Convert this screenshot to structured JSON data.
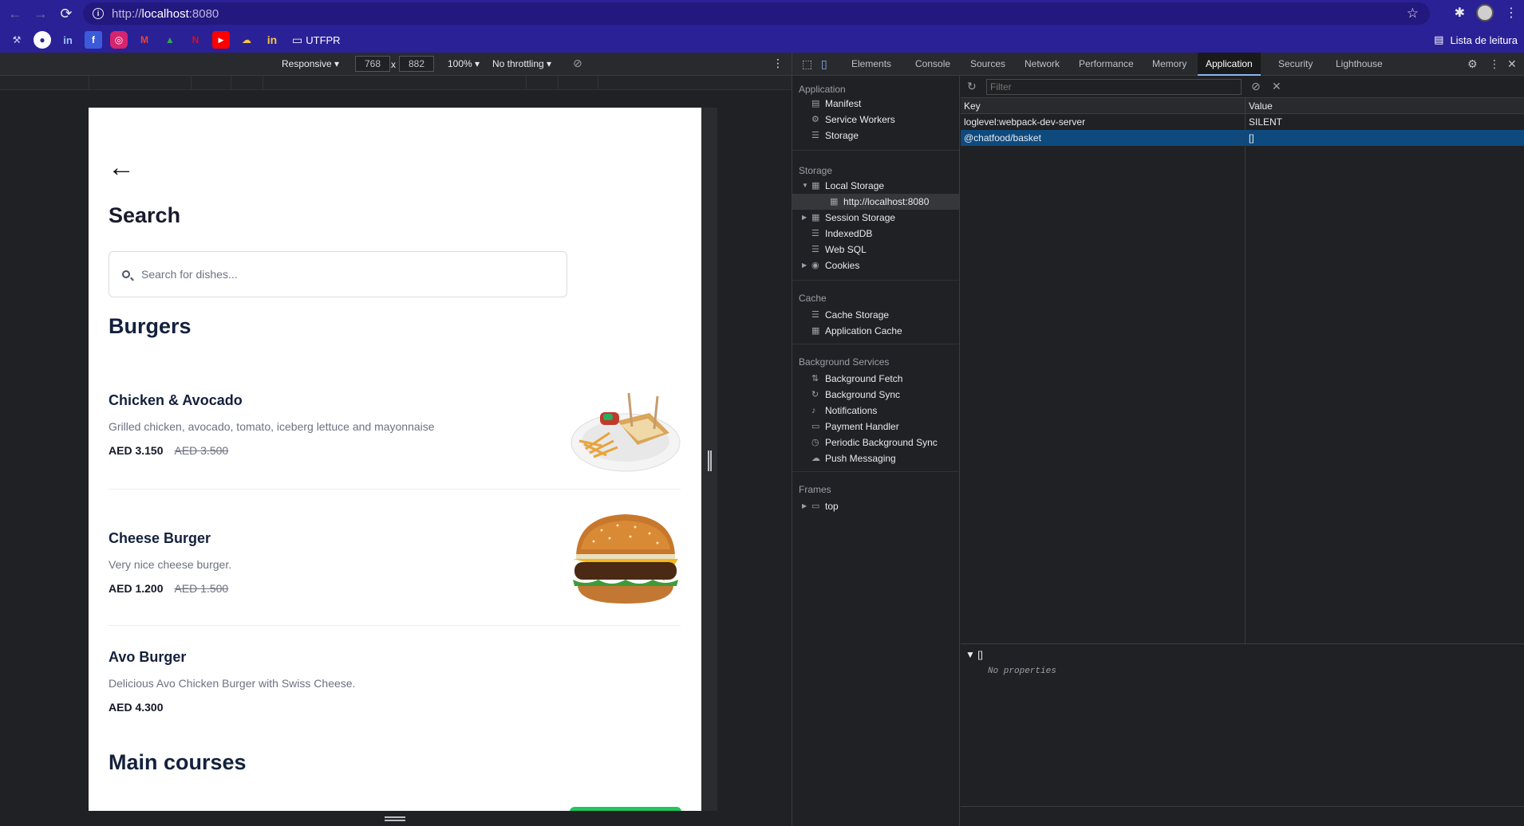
{
  "browser": {
    "url_scheme": "http://",
    "url_host": "localhost",
    "url_port": ":8080",
    "bookmark_folder": "UTFPR",
    "reading_list": "Lista de leitura",
    "bookmark_icons": [
      "tools-icon",
      "github-icon",
      "linkedin-icon",
      "facebook-icon",
      "instagram-icon",
      "gmail-icon",
      "google-drive-icon",
      "netflix-icon",
      "youtube-icon",
      "gamepad-icon",
      "linkedin-icon"
    ]
  },
  "device_toolbar": {
    "mode": "Responsive ▾",
    "width": "768",
    "times": "x",
    "height": "882",
    "zoom": "100% ▾",
    "throttling": "No throttling ▾"
  },
  "page": {
    "title": "Search",
    "search_placeholder": "Search for dishes...",
    "sections": [
      {
        "title": "Burgers",
        "dishes": [
          {
            "name": "Chicken & Avocado",
            "description": "Grilled chicken, avocado, tomato, iceberg lettuce and mayonnaise",
            "price": "AED 3.150",
            "old_price": "AED 3.500"
          },
          {
            "name": "Cheese Burger",
            "description": "Very nice cheese burger.",
            "price": "AED 1.200",
            "old_price": "AED 1.500"
          },
          {
            "name": "Avo Burger",
            "description": "Delicious Avo Chicken Burger with Swiss Cheese.",
            "price": "AED 4.300"
          }
        ]
      },
      {
        "title": "Main courses"
      }
    ]
  },
  "devtools": {
    "tabs": [
      "Elements",
      "Console",
      "Sources",
      "Network",
      "Performance",
      "Memory",
      "Application",
      "Security",
      "Lighthouse"
    ],
    "active_tab": "Application",
    "sidebar": {
      "application_group": "Application",
      "application_items": [
        "Manifest",
        "Service Workers",
        "Storage"
      ],
      "storage_group": "Storage",
      "storage_items": [
        "Local Storage",
        "http://localhost:8080",
        "Session Storage",
        "IndexedDB",
        "Web SQL",
        "Cookies"
      ],
      "cache_group": "Cache",
      "cache_items": [
        "Cache Storage",
        "Application Cache"
      ],
      "background_group": "Background Services",
      "background_items": [
        "Background Fetch",
        "Background Sync",
        "Notifications",
        "Payment Handler",
        "Periodic Background Sync",
        "Push Messaging"
      ],
      "frames_group": "Frames",
      "frames_items": [
        "top"
      ]
    },
    "filter_placeholder": "Filter",
    "table": {
      "key_header": "Key",
      "value_header": "Value",
      "rows": [
        {
          "key": "loglevel:webpack-dev-server",
          "value": "SILENT"
        },
        {
          "key": "@chatfood/basket",
          "value": "[]"
        }
      ]
    },
    "preview": {
      "value": "▼ []",
      "empty_text": "No properties"
    }
  }
}
